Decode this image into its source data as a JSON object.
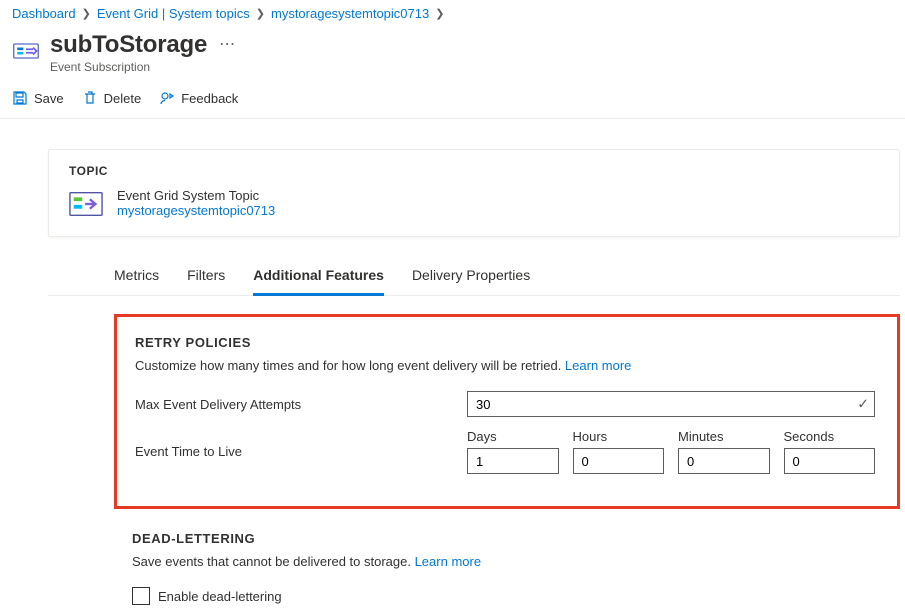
{
  "breadcrumb": [
    {
      "label": "Dashboard"
    },
    {
      "label": "Event Grid | System topics"
    },
    {
      "label": "mystoragesystemtopic0713"
    }
  ],
  "header": {
    "title": "subToStorage",
    "subtitle": "Event Subscription"
  },
  "commands": {
    "save": "Save",
    "delete": "Delete",
    "feedback": "Feedback"
  },
  "topic": {
    "label": "TOPIC",
    "type": "Event Grid System Topic",
    "link": "mystoragesystemtopic0713"
  },
  "tabs": {
    "metrics": "Metrics",
    "filters": "Filters",
    "additional": "Additional Features",
    "delivery": "Delivery Properties",
    "activeIndex": 2
  },
  "retry": {
    "title": "RETRY POLICIES",
    "desc": "Customize how many times and for how long event delivery will be retried. ",
    "learn": "Learn more",
    "maxLabel": "Max Event Delivery Attempts",
    "maxValue": "30",
    "ttlLabel": "Event Time to Live",
    "ttl": {
      "daysLabel": "Days",
      "days": "1",
      "hoursLabel": "Hours",
      "hours": "0",
      "minutesLabel": "Minutes",
      "minutes": "0",
      "secondsLabel": "Seconds",
      "seconds": "0"
    }
  },
  "deadletter": {
    "title": "DEAD-LETTERING",
    "desc": "Save events that cannot be delivered to storage. ",
    "learn": "Learn more",
    "checkbox": "Enable dead-lettering",
    "checked": false
  }
}
